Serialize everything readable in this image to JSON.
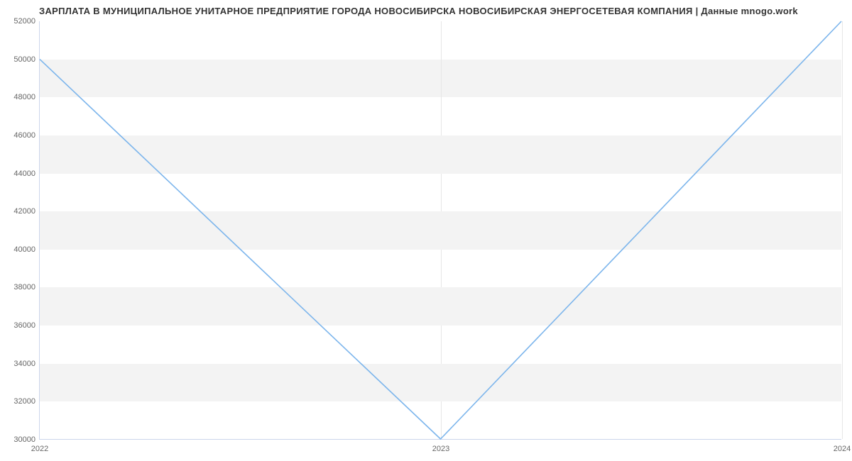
{
  "chart_data": {
    "type": "line",
    "title": "ЗАРПЛАТА В МУНИЦИПАЛЬНОЕ УНИТАРНОЕ ПРЕДПРИЯТИЕ ГОРОДА НОВОСИБИРСКА НОВОСИБИРСКАЯ ЭНЕРГОСЕТЕВАЯ КОМПАНИЯ | Данные mnogo.work",
    "categories": [
      "2022",
      "2023",
      "2024"
    ],
    "values": [
      50000,
      30000,
      52000
    ],
    "xlabel": "",
    "ylabel": "",
    "ylim": [
      30000,
      52000
    ],
    "yticks": [
      30000,
      32000,
      34000,
      36000,
      38000,
      40000,
      42000,
      44000,
      46000,
      48000,
      50000,
      52000
    ],
    "legend": false,
    "grid": "banded"
  }
}
